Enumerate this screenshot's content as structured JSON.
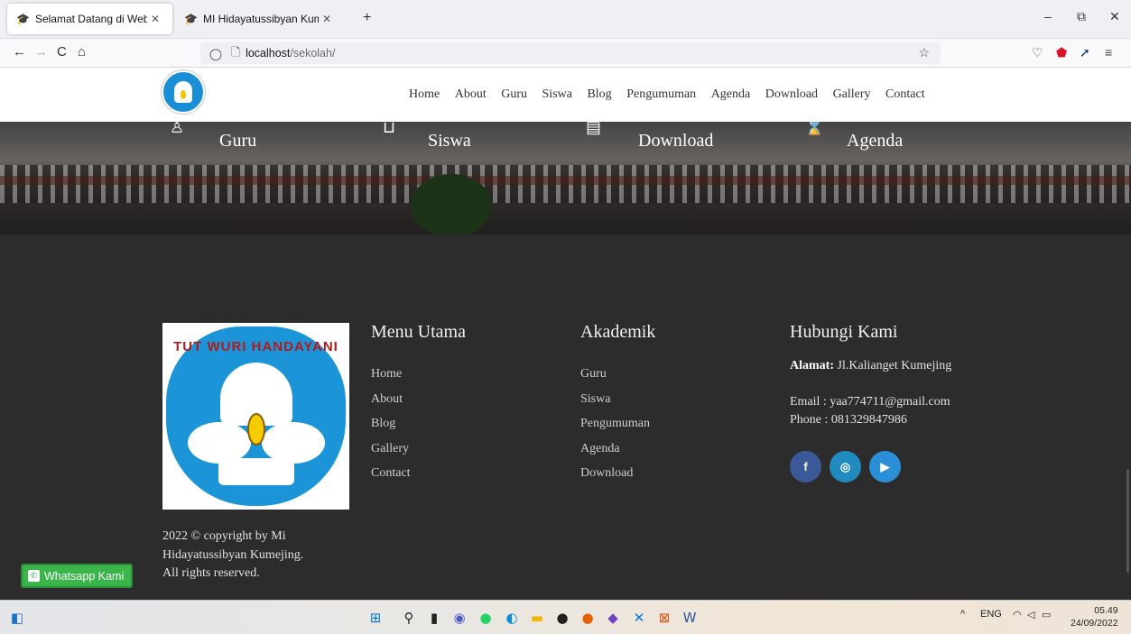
{
  "browser": {
    "tabs": [
      {
        "icon": "graduation-cap-icon",
        "title": "Selamat Datang di Website Sek",
        "active": true
      },
      {
        "icon": "graduation-cap-icon",
        "title": "MI Hidayatussibyan Kumejing |",
        "active": false
      }
    ],
    "new_tab_symbol": "+",
    "window_controls": {
      "minimize": "–",
      "restore": "⧉",
      "close": "✕"
    },
    "nav": {
      "back": "←",
      "forward": "→",
      "reload": "C",
      "home": "⌂"
    },
    "url_host": "localhost",
    "url_path": "/sekolah/",
    "bookmark_symbol": "☆"
  },
  "site": {
    "nav": [
      "Home",
      "About",
      "Guru",
      "Siswa",
      "Blog",
      "Pengumuman",
      "Agenda",
      "Download",
      "Gallery",
      "Contact"
    ],
    "features": [
      {
        "icon": "teacher-icon",
        "label": "Guru"
      },
      {
        "icon": "student-icon",
        "label": "Siswa"
      },
      {
        "icon": "book-icon",
        "label": "Download"
      },
      {
        "icon": "hourglass-icon",
        "label": "Agenda"
      }
    ]
  },
  "footer": {
    "logo_text": "TUT WURI HANDAYANI",
    "menu_utama": {
      "title": "Menu Utama",
      "items": [
        "Home",
        "About",
        "Blog",
        "Gallery",
        "Contact"
      ]
    },
    "akademik": {
      "title": "Akademik",
      "items": [
        "Guru",
        "Siswa",
        "Pengumuman",
        "Agenda",
        "Download"
      ]
    },
    "hubungi": {
      "title": "Hubungi Kami",
      "address_label": "Alamat:",
      "address": "Jl.Kalianget Kumejing",
      "email": "Email : yaa774711@gmail.com",
      "phone": "Phone : 081329847986"
    },
    "socials": [
      {
        "name": "facebook",
        "glyph": "f",
        "color": "#3b5998"
      },
      {
        "name": "instagram",
        "glyph": "◎",
        "color": "#1f8bbf"
      },
      {
        "name": "youtube",
        "glyph": "▶",
        "color": "#2a8fd6"
      }
    ],
    "copyright_lines": [
      "2022 © copyright by Mi",
      "Hidayatussibyan Kumejing.",
      "All rights reserved."
    ]
  },
  "whatsapp_button": "Whatsapp Kami",
  "taskbar": {
    "language": "ENG",
    "time": "05.49",
    "date": "24/09/2022"
  }
}
